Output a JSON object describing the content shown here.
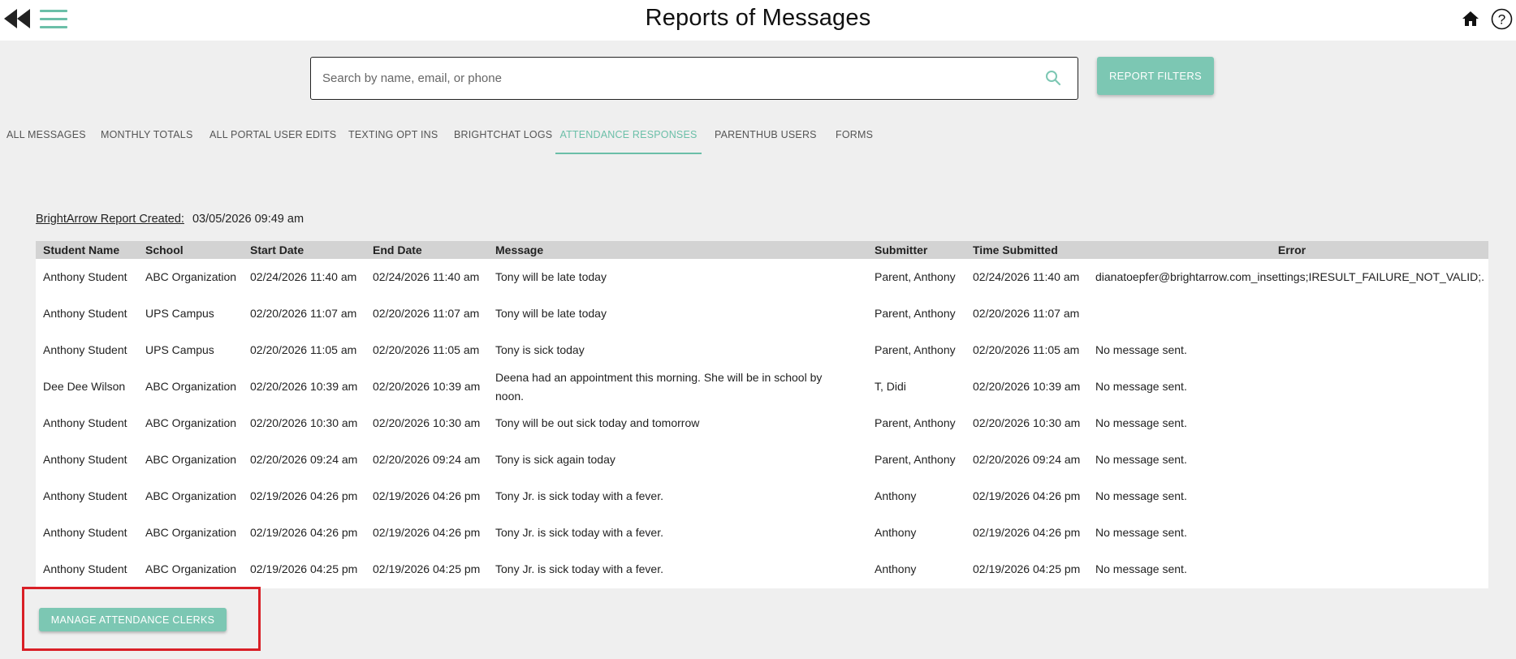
{
  "header": {
    "title": "Reports of Messages"
  },
  "search": {
    "placeholder": "Search by name, email, or phone",
    "value": ""
  },
  "buttons": {
    "report_filters": "REPORT FILTERS",
    "manage_attendance_clerks": "MANAGE ATTENDANCE CLERKS"
  },
  "tabs": [
    {
      "label": "ALL MESSAGES",
      "active": false
    },
    {
      "label": "MONTHLY TOTALS",
      "active": false
    },
    {
      "label": "ALL PORTAL USER EDITS",
      "active": false
    },
    {
      "label": "TEXTING OPT INS",
      "active": false
    },
    {
      "label": "BRIGHTCHAT LOGS",
      "active": false
    },
    {
      "label": "ATTENDANCE RESPONSES",
      "active": true
    },
    {
      "label": "PARENTHUB USERS",
      "active": false
    },
    {
      "label": "FORMS",
      "active": false
    }
  ],
  "report": {
    "created_label": "BrightArrow Report Created:",
    "created_value": "03/05/2026 09:49 am"
  },
  "table": {
    "columns": [
      "Student Name",
      "School",
      "Start Date",
      "End Date",
      "Message",
      "Submitter",
      "Time Submitted",
      "Error"
    ],
    "rows": [
      [
        "Anthony Student",
        "ABC Organization",
        "02/24/2026 11:40 am",
        "02/24/2026 11:40 am",
        "Tony will be late today",
        "Parent, Anthony",
        "02/24/2026 11:40 am",
        "dianatoepfer@brightarrow.com_insettings;IRESULT_FAILURE_NOT_VALID;."
      ],
      [
        "Anthony Student",
        "UPS Campus",
        "02/20/2026 11:07 am",
        "02/20/2026 11:07 am",
        "Tony will be late today",
        "Parent, Anthony",
        "02/20/2026 11:07 am",
        ""
      ],
      [
        "Anthony Student",
        "UPS Campus",
        "02/20/2026 11:05 am",
        "02/20/2026 11:05 am",
        "Tony is sick today",
        "Parent, Anthony",
        "02/20/2026 11:05 am",
        "No message sent."
      ],
      [
        "Dee Dee Wilson",
        "ABC Organization",
        "02/20/2026 10:39 am",
        "02/20/2026 10:39 am",
        "Deena had an appointment this morning. She will be in school by noon.",
        "T, Didi",
        "02/20/2026 10:39 am",
        "No message sent."
      ],
      [
        "Anthony Student",
        "ABC Organization",
        "02/20/2026 10:30 am",
        "02/20/2026 10:30 am",
        "Tony will be out sick today and tomorrow",
        "Parent, Anthony",
        "02/20/2026 10:30 am",
        "No message sent."
      ],
      [
        "Anthony Student",
        "ABC Organization",
        "02/20/2026 09:24 am",
        "02/20/2026 09:24 am",
        "Tony is sick again today",
        "Parent, Anthony",
        "02/20/2026 09:24 am",
        "No message sent."
      ],
      [
        "Anthony Student",
        "ABC Organization",
        "02/19/2026 04:26 pm",
        "02/19/2026 04:26 pm",
        "Tony Jr. is sick today with a fever.",
        "Anthony",
        "02/19/2026 04:26 pm",
        "No message sent."
      ],
      [
        "Anthony Student",
        "ABC Organization",
        "02/19/2026 04:26 pm",
        "02/19/2026 04:26 pm",
        "Tony Jr. is sick today with a fever.",
        "Anthony",
        "02/19/2026 04:26 pm",
        "No message sent."
      ],
      [
        "Anthony Student",
        "ABC Organization",
        "02/19/2026 04:25 pm",
        "02/19/2026 04:25 pm",
        "Tony Jr. is sick today with a fever.",
        "Anthony",
        "02/19/2026 04:25 pm",
        "No message sent."
      ]
    ]
  },
  "icons": {
    "back": "rewind-icon",
    "menu": "hamburger-menu-icon",
    "search": "search-icon",
    "home": "home-icon",
    "help": "help-icon"
  },
  "colors": {
    "accent": "#7cc7b3",
    "active_tab": "#6bbfa8",
    "highlight": "#d91f26"
  }
}
